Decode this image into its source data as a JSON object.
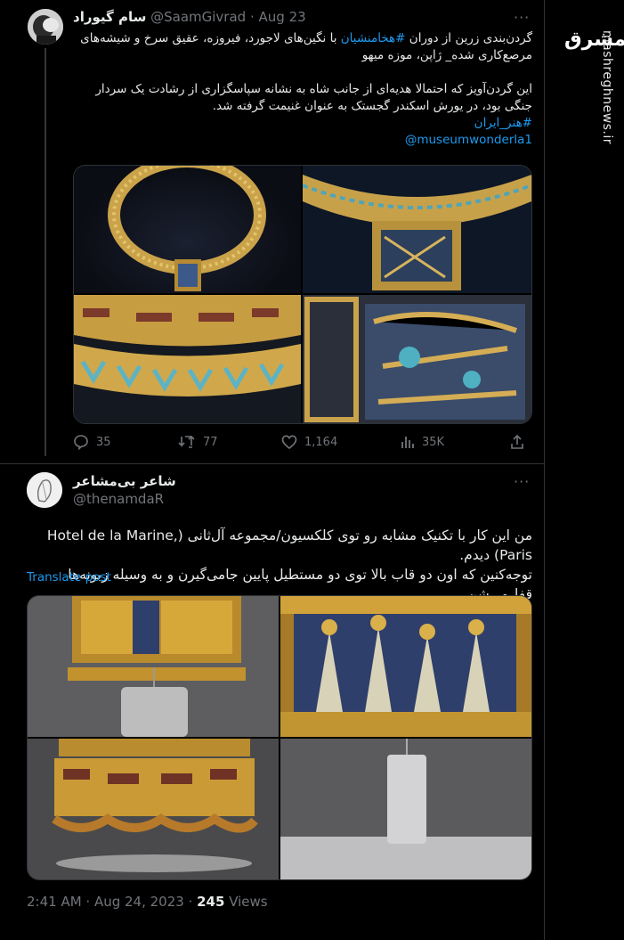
{
  "brand": {
    "logo_text": "مشرق",
    "url": "mashreghnews.ir"
  },
  "tweet1": {
    "display_name": "سام گیوراد",
    "handle": "@SaamGivrad",
    "date": "Aug 23",
    "more_label": "···",
    "line1_pre": "گردن‌بندی زرین از دوران ",
    "hashtag1": "#هخامنشیان",
    "line1_post": " با نگین‌های لاجورد، فیروزه، عقیق سرخ و شیشه‌های",
    "line2": "مرصع‌کاری شده_ ژاپن، موزه میهو",
    "para2": "این گردن‌آویز که احتمالا هدیه‌ای از جانب شاه به نشانه سپاسگزاری از رشادت یک سردار جنگی بود، در یورش اسکندر گجستک به عنوان غنیمت گرفته شد.",
    "hashtag2": "#هنر_ایران",
    "mention": "@museumwonderla1",
    "stats": {
      "replies": "35",
      "retweets": "77",
      "likes": "1,164",
      "views": "35K"
    }
  },
  "tweet2": {
    "display_name": "شاعر بی‌مشاعر",
    "handle": "@thenamdaR",
    "more_label": "···",
    "text_line1": "من این کار با تکنیک مشابه رو توی کلکسیون/مجموعه آل‌ثانی (Hotel de la Marine, Paris) دیدم.",
    "text_line2": "توجه‌کنین که اون دو قاب بالا توی دو مستطیل پایین جامی‌گیرن و به وسیله زبونه‌ها قفل‌می‌شن.",
    "translate_label": "Translate post",
    "footer_time": "2:41 AM · Aug 24, 2023 · ",
    "footer_views_count": "245",
    "footer_views_label": " Views"
  }
}
